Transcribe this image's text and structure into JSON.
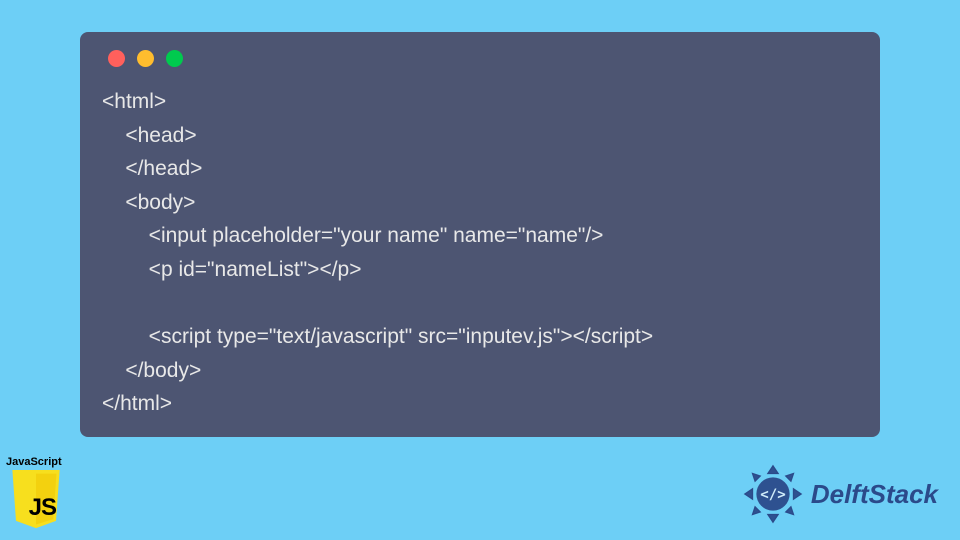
{
  "code": {
    "lines": "<html>\n    <head>\n    </head>\n    <body>\n        <input placeholder=\"your name\" name=\"name\"/>\n        <p id=\"nameList\"></p>\n\n        <script type=\"text/javascript\" src=\"inputev.js\"></script>\n    </body>\n</html>"
  },
  "badges": {
    "js_label": "JavaScript",
    "js_abbrev": "JS",
    "brand_name": "DelftStack"
  },
  "colors": {
    "background": "#6dcff6",
    "window": "#4d5572",
    "code_text": "#e8e8e8",
    "dot_red": "#ff605c",
    "dot_yellow": "#ffbd2e",
    "dot_green": "#00ca4e",
    "js_shield": "#f7df1e",
    "brand": "#2b4a8a"
  }
}
